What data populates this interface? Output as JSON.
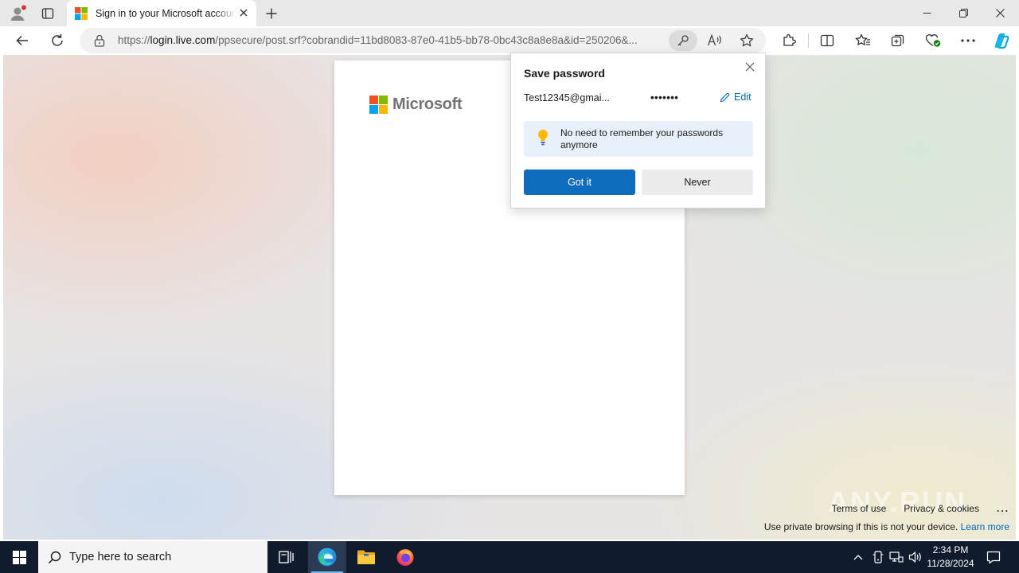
{
  "browser": {
    "tab": {
      "title": "Sign in to your Microsoft account"
    },
    "address": {
      "prefix": "https://",
      "host": "login.live.com",
      "path": "/ppsecure/post.srf?cobrandid=11bd8083-87e0-41b5-bb78-0bc43c8a8e8a&id=250206&..."
    }
  },
  "page": {
    "brand": "Microsoft",
    "footer": {
      "terms": "Terms of use",
      "privacy": "Privacy & cookies",
      "more": "...",
      "note": "Use private browsing if this is not your device.",
      "learn_more": "Learn more"
    },
    "watermark": "ANY.RUN"
  },
  "save_password": {
    "title": "Save password",
    "username": "Test12345@gmai...",
    "password_masked": "•••••••",
    "edit_label": "Edit",
    "tip": "No need to remember your passwords anymore",
    "primary_label": "Got it",
    "secondary_label": "Never"
  },
  "taskbar": {
    "search_placeholder": "Type here to search",
    "time": "2:34 PM",
    "date": "11/28/2024"
  },
  "colors": {
    "accent": "#0f6cbd",
    "link": "#0067b8",
    "taskbar": "#101c2e",
    "ms_red": "#f25022",
    "ms_green": "#7fba00",
    "ms_blue": "#00a4ef",
    "ms_yellow": "#ffb900"
  }
}
